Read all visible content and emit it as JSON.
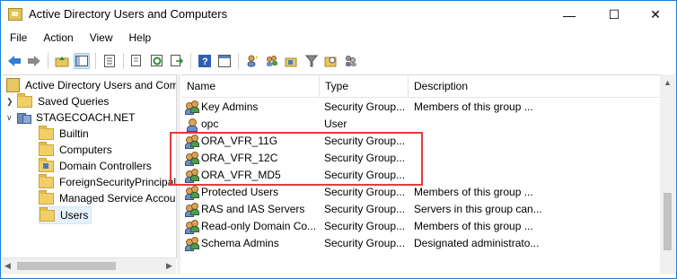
{
  "window": {
    "title": "Active Directory Users and Computers",
    "minimize": "—",
    "maximize": "☐",
    "close": "✕"
  },
  "menu": [
    "File",
    "Action",
    "View",
    "Help"
  ],
  "toolbar_icons": [
    "back-arrow-icon",
    "forward-arrow-icon",
    "up-folder-icon",
    "show-tree-icon",
    "properties-icon",
    "copy-icon",
    "refresh-icon",
    "export-icon",
    "help-icon",
    "console-icon",
    "new-user-icon",
    "new-group-icon",
    "new-ou-icon",
    "filter-icon",
    "find-icon",
    "delegate-icon"
  ],
  "tree": {
    "root": "Active Directory Users and Com",
    "saved_queries": "Saved Queries",
    "domain": "STAGECOACH.NET",
    "children": [
      "Builtin",
      "Computers",
      "Domain Controllers",
      "ForeignSecurityPrincipals",
      "Managed Service Accounts",
      "Users"
    ]
  },
  "list": {
    "columns": {
      "name": "Name",
      "type": "Type",
      "description": "Description"
    },
    "rows": [
      {
        "icon": "group-icon",
        "name": "Key Admins",
        "type": "Security Group...",
        "description": "Members of this group ..."
      },
      {
        "icon": "user-icon",
        "name": "opc",
        "type": "User",
        "description": ""
      },
      {
        "icon": "group-icon",
        "name": "ORA_VFR_11G",
        "type": "Security Group...",
        "description": ""
      },
      {
        "icon": "group-icon",
        "name": "ORA_VFR_12C",
        "type": "Security Group...",
        "description": ""
      },
      {
        "icon": "group-icon",
        "name": "ORA_VFR_MD5",
        "type": "Security Group...",
        "description": ""
      },
      {
        "icon": "group-icon",
        "name": "Protected Users",
        "type": "Security Group...",
        "description": "Members of this group ..."
      },
      {
        "icon": "group-icon",
        "name": "RAS and IAS Servers",
        "type": "Security Group...",
        "description": "Servers in this group can..."
      },
      {
        "icon": "group-icon",
        "name": "Read-only Domain Co...",
        "type": "Security Group...",
        "description": "Members of this group ..."
      },
      {
        "icon": "group-icon",
        "name": "Schema Admins",
        "type": "Security Group...",
        "description": "Designated administrato..."
      }
    ]
  },
  "colors": {
    "highlight_border": "#e43b3b",
    "selection_bg": "#e5f1fb",
    "window_border": "#1e7fd8"
  }
}
